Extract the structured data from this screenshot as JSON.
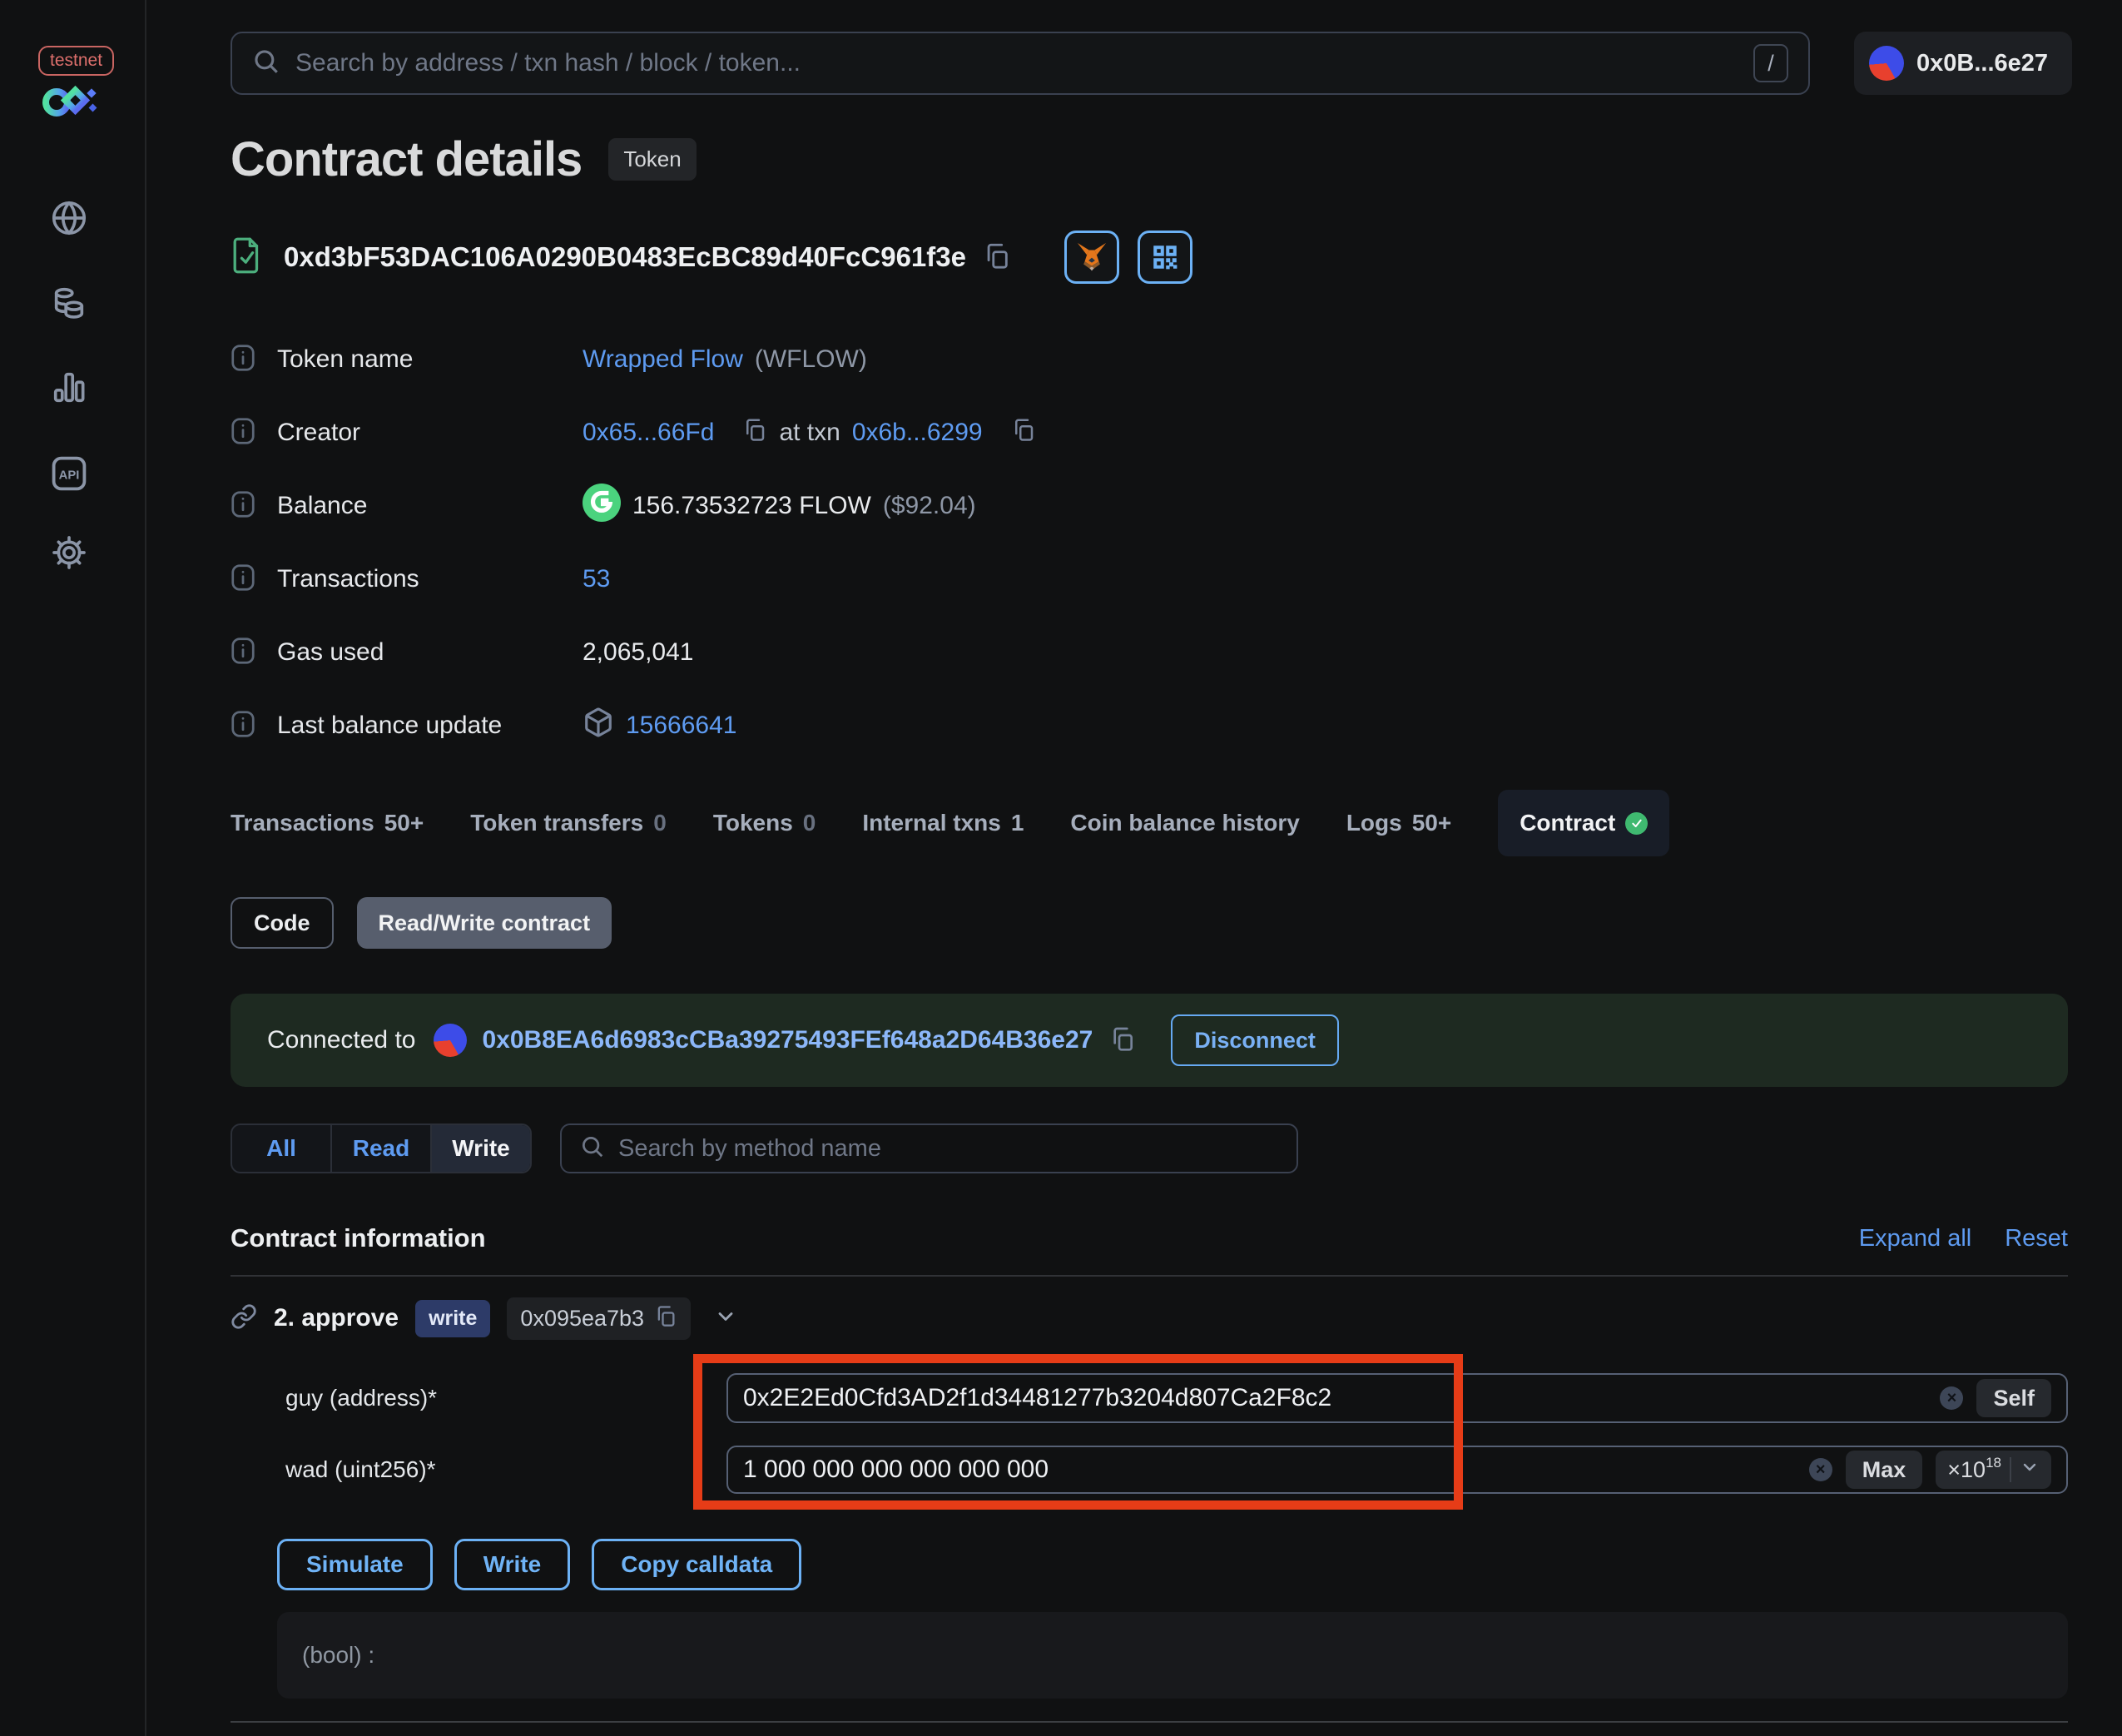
{
  "sidebar": {
    "network_badge": "testnet"
  },
  "topbar": {
    "search_placeholder": "Search by address / txn hash / block / token...",
    "search_shortcut": "/",
    "account_label": "0x0B...6e27"
  },
  "page": {
    "title": "Contract details",
    "type_badge": "Token",
    "address": "0xd3bF53DAC106A0290B0483EcBC89d40FcC961f3e"
  },
  "info": {
    "token_name": {
      "label": "Token name",
      "value": "Wrapped Flow",
      "symbol": "(WFLOW)"
    },
    "creator": {
      "label": "Creator",
      "address": "0x65...66Fd",
      "connector": "at txn",
      "txn": "0x6b...6299"
    },
    "balance": {
      "label": "Balance",
      "value": "156.73532723 FLOW",
      "usd": "($92.04)"
    },
    "transactions": {
      "label": "Transactions",
      "value": "53"
    },
    "gas_used": {
      "label": "Gas used",
      "value": "2,065,041"
    },
    "last_balance_update": {
      "label": "Last balance update",
      "value": "15666641"
    }
  },
  "tabs": {
    "items": [
      {
        "label": "Transactions",
        "count": "50+"
      },
      {
        "label": "Token transfers",
        "count": "0"
      },
      {
        "label": "Tokens",
        "count": "0"
      },
      {
        "label": "Internal txns",
        "count": "1"
      },
      {
        "label": "Coin balance history",
        "count": ""
      },
      {
        "label": "Logs",
        "count": "50+"
      },
      {
        "label": "Contract",
        "count": ""
      }
    ]
  },
  "subtabs": {
    "code": "Code",
    "read_write": "Read/Write contract"
  },
  "connected": {
    "label": "Connected to",
    "address": "0x0B8EA6d6983cCBa39275493FEf648a2D64B36e27",
    "disconnect": "Disconnect"
  },
  "methods_filter": {
    "all": "All",
    "read": "Read",
    "write": "Write",
    "search_placeholder": "Search by method name"
  },
  "contract_info": {
    "title": "Contract information",
    "expand_all": "Expand all",
    "reset": "Reset"
  },
  "method": {
    "name": "2. approve",
    "badge": "write",
    "selector": "0x095ea7b3"
  },
  "fields": {
    "guy": {
      "label": "guy (address)*",
      "value": "0x2E2Ed0Cfd3AD2f1d34481277b3204d807Ca2F8c2",
      "self_button": "Self",
      "clear": "×"
    },
    "wad": {
      "label": "wad (uint256)*",
      "value": "1 000 000 000 000 000 000",
      "max_button": "Max",
      "multiplier_base": "×10",
      "multiplier_exponent": "18",
      "clear": "×"
    }
  },
  "actions": {
    "simulate": "Simulate",
    "write": "Write",
    "copy_calldata": "Copy calldata"
  },
  "output": {
    "result": "(bool) :"
  },
  "colors": {
    "link_blue": "#5e9bf1",
    "light_blue": "#8cb7f9",
    "button_blue": "#6cb1f5",
    "success_green": "#49c97e",
    "annotation_red": "#e63c17"
  }
}
